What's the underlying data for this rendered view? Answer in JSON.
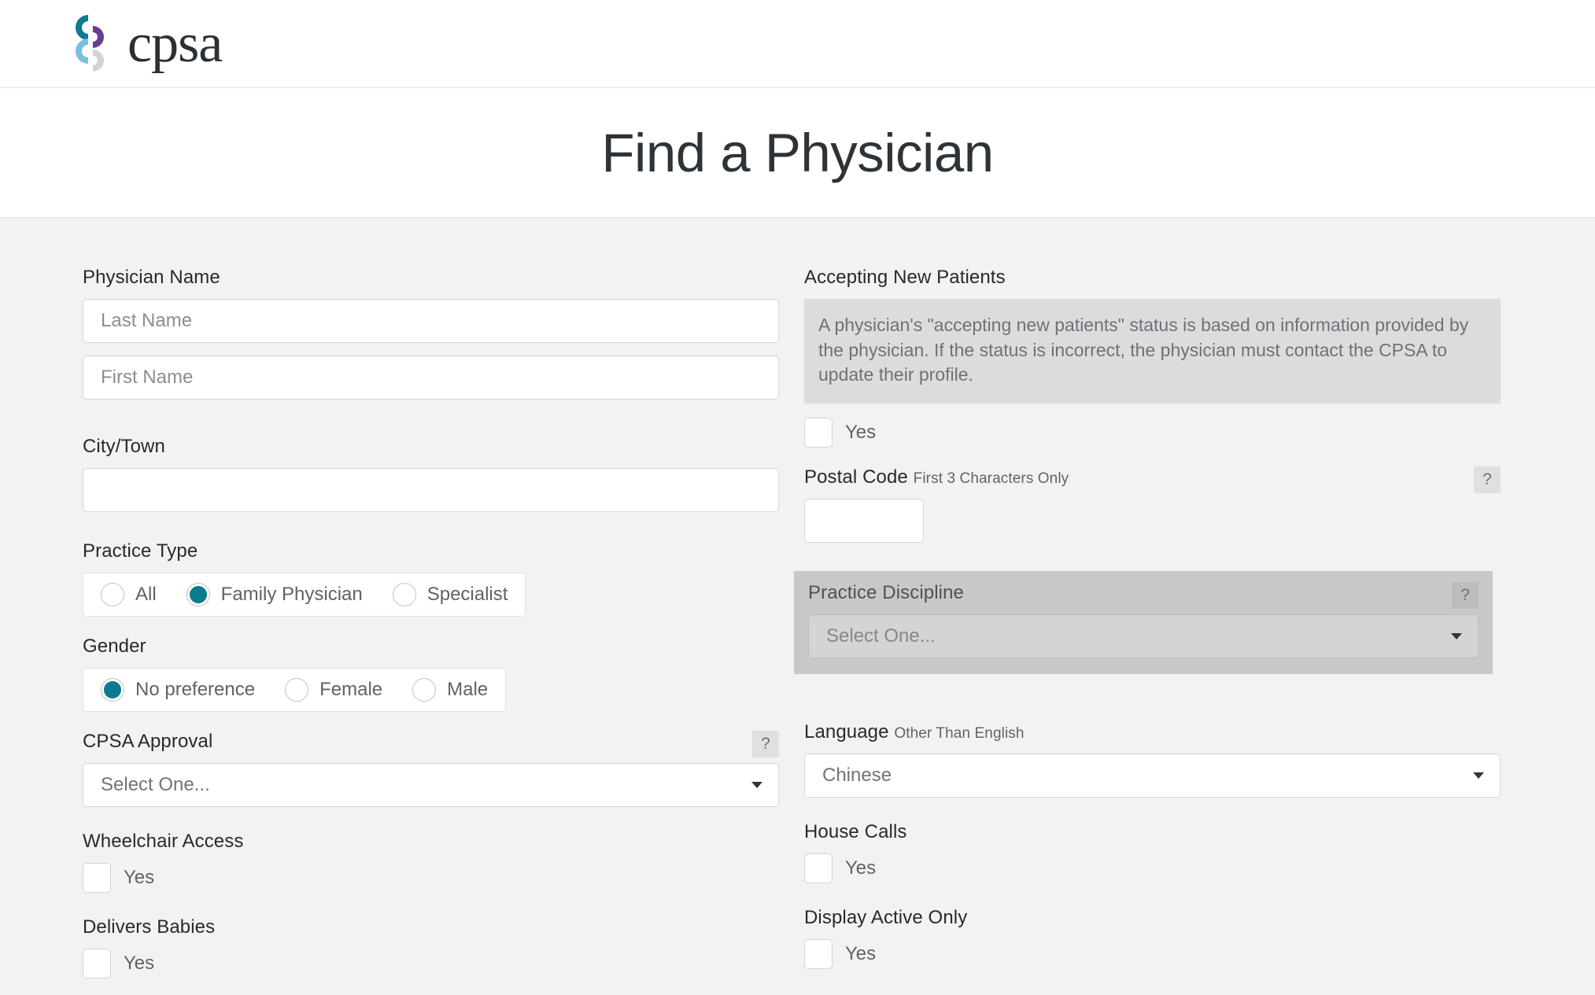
{
  "brand": {
    "name": "cpsa",
    "mark_colors": [
      "#0d7b8e",
      "#6b3d8f",
      "#79bfe0",
      "#d2d4d6"
    ]
  },
  "header": {
    "page_title": "Find a Physician"
  },
  "theme": {
    "accent": "#0c7b8f",
    "panel_bg": "#f2f2f2",
    "notice_bg": "#dcdcdc",
    "disabled_bg": "#c8c8c8"
  },
  "form": {
    "left": {
      "physician_name": {
        "label": "Physician Name",
        "last_name_placeholder": "Last Name",
        "last_name_value": "",
        "first_name_placeholder": "First Name",
        "first_name_value": ""
      },
      "city_town": {
        "label": "City/Town",
        "value": "",
        "placeholder": ""
      },
      "practice_type": {
        "label": "Practice Type",
        "options": [
          {
            "label": "All",
            "selected": false
          },
          {
            "label": "Family Physician",
            "selected": true
          },
          {
            "label": "Specialist",
            "selected": false
          }
        ]
      },
      "gender": {
        "label": "Gender",
        "options": [
          {
            "label": "No preference",
            "selected": true
          },
          {
            "label": "Female",
            "selected": false
          },
          {
            "label": "Male",
            "selected": false
          }
        ]
      },
      "cpsa_approval": {
        "label": "CPSA Approval",
        "help": "?",
        "selected": "Select One..."
      },
      "wheelchair_access": {
        "label": "Wheelchair Access",
        "checkbox_label": "Yes",
        "checked": false
      },
      "delivers_babies": {
        "label": "Delivers Babies",
        "checkbox_label": "Yes",
        "checked": false
      }
    },
    "right": {
      "accepting_new_patients": {
        "label": "Accepting New Patients",
        "notice": "A physician's \"accepting new patients\" status is based on information provided by the physician. If the status is incorrect, the physician must contact the CPSA to update their profile.",
        "checkbox_label": "Yes",
        "checked": false
      },
      "postal_code": {
        "label": "Postal Code",
        "sub_label": "First 3 Characters Only",
        "help": "?",
        "value": "",
        "placeholder": ""
      },
      "practice_discipline": {
        "label": "Practice Discipline",
        "help": "?",
        "selected": "Select One...",
        "disabled": true
      },
      "language": {
        "label": "Language",
        "sub_label": "Other Than English",
        "selected": "Chinese"
      },
      "house_calls": {
        "label": "House Calls",
        "checkbox_label": "Yes",
        "checked": false
      },
      "display_active_only": {
        "label": "Display Active Only",
        "checkbox_label": "Yes",
        "checked": false
      }
    }
  }
}
